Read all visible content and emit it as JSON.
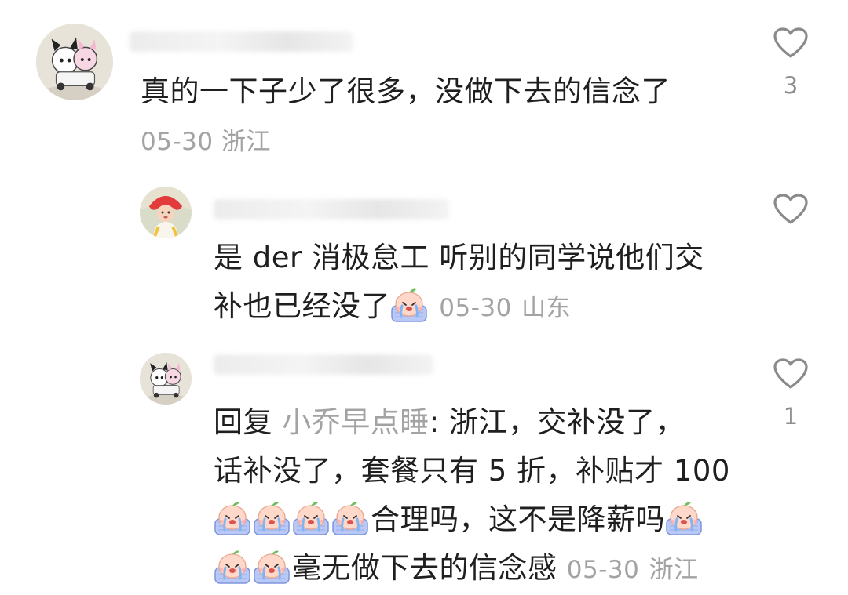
{
  "comments": [
    {
      "text": "真的一下子少了很多，没做下去的信念了",
      "date": "05-30",
      "location": "浙江",
      "likes": "3",
      "avatar": "plush-toys-avatar"
    },
    {
      "text_line1": "是 der 消极怠工 听别的同学说他们交",
      "text_line2": "补也已经没了",
      "date": "05-30",
      "location": "山东",
      "likes": "",
      "avatar": "baby-photo-avatar"
    },
    {
      "reply_prefix": "回复",
      "reply_to": "小乔早点睡",
      "line1_rest": ": 浙江，交补没了，",
      "line2": "话补没了，套餐只有 5 折，补贴才 100",
      "line3_text": "合理吗，这不是降薪吗",
      "line4_text": "毫无做下去的信念感",
      "date": "05-30",
      "location": "浙江",
      "likes": "1",
      "avatar": "plush-toys-avatar"
    }
  ],
  "icons": {
    "like": "heart-outline-icon",
    "emoji": "crying-peach-emoji"
  }
}
